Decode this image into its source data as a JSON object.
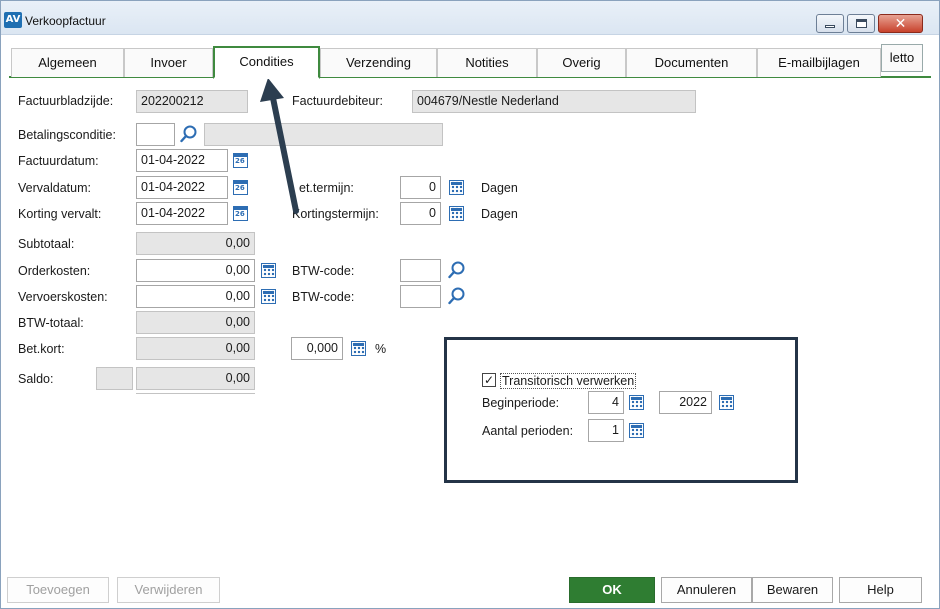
{
  "window": {
    "title": "Verkoopfactuur",
    "app_icon": "AV"
  },
  "tabs": [
    {
      "label": "Algemeen"
    },
    {
      "label": "Invoer"
    },
    {
      "label": "Condities",
      "active": true
    },
    {
      "label": "Verzending"
    },
    {
      "label": "Notities"
    },
    {
      "label": "Overig"
    },
    {
      "label": "Documenten"
    },
    {
      "label": "E-mailbijlagen"
    },
    {
      "label": "letto"
    }
  ],
  "form": {
    "factuurbladzijde": {
      "label": "Factuurbladzijde:",
      "value": "202200212"
    },
    "factuurdebiteur": {
      "label": "Factuurdebiteur:",
      "value": "004679/Nestle Nederland"
    },
    "betalingsconditie": {
      "label": "Betalingsconditie:",
      "code": "",
      "description": ""
    },
    "factuurdatum": {
      "label": "Factuurdatum:",
      "value": "01-04-2022"
    },
    "vervaldatum": {
      "label": "Vervaldatum:",
      "value": "01-04-2022"
    },
    "korting_vervalt": {
      "label": "Korting vervalt:",
      "value": "01-04-2022"
    },
    "bet_termijn": {
      "label": "et.termijn:",
      "value": "0",
      "unit": "Dagen"
    },
    "kortingstermijn": {
      "label": "Kortingstermijn:",
      "value": "0",
      "unit": "Dagen"
    },
    "subtotaal": {
      "label": "Subtotaal:",
      "value": "0,00"
    },
    "orderkosten": {
      "label": "Orderkosten:",
      "value": "0,00"
    },
    "vervoerskosten": {
      "label": "Vervoerskosten:",
      "value": "0,00"
    },
    "btw_code_1": {
      "label": "BTW-code:",
      "value": ""
    },
    "btw_code_2": {
      "label": "BTW-code:",
      "value": ""
    },
    "btw_totaal": {
      "label": "BTW-totaal:",
      "value": "0,00"
    },
    "bet_kort": {
      "label": "Bet.kort:",
      "value": "0,00",
      "percent": "0,000",
      "percent_unit": "%"
    },
    "saldo": {
      "label": "Saldo:",
      "prefix": "",
      "value": "0,00"
    }
  },
  "transitorisch": {
    "checkbox_label": "Transitorisch verwerken",
    "checked": true,
    "beginperiode": {
      "label": "Beginperiode:",
      "period": "4",
      "year": "2022"
    },
    "aantal_perioden": {
      "label": "Aantal perioden:",
      "value": "1"
    }
  },
  "calendar_day": "26",
  "buttons": {
    "toevoegen": "Toevoegen",
    "verwijderen": "Verwijderen",
    "ok": "OK",
    "annuleren": "Annuleren",
    "bewaren": "Bewaren",
    "help": "Help"
  },
  "colors": {
    "accent_green": "#3f8a3f",
    "ok_button": "#2f7d32",
    "highlight_border": "#243447"
  }
}
